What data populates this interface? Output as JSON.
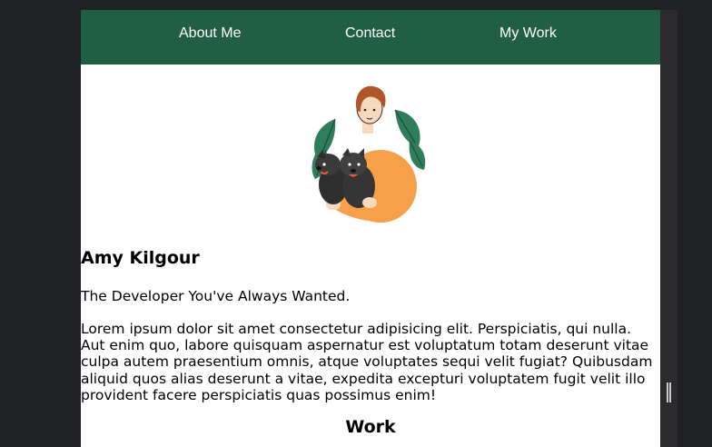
{
  "nav": {
    "links": [
      {
        "label": "About Me"
      },
      {
        "label": "Contact"
      },
      {
        "label": "My Work"
      }
    ]
  },
  "profile": {
    "name": "Amy Kilgour",
    "tagline": "The Developer You've Always Wanted.",
    "bio": "Lorem ipsum dolor sit amet consectetur adipisicing elit. Perspiciatis, qui nulla. Aut enim quo, labore quisquam aspernatur est voluptatum totam deserunt vitae culpa autem praesentium omnis, atque voluptates sequi velit fugiat? Quibusdam aliquid quos alias deserunt a vitae, expedita excepturi voluptatem fugit velit illo provident facere perspiciatis quas possimus enim!"
  },
  "sections": {
    "work_heading": "Work"
  },
  "colors": {
    "nav_background": "#215f45",
    "page_background": "#ffffff",
    "outer_background": "#202124",
    "sweater": "#f7a04a",
    "leaf": "#2f7d5b",
    "hair": "#b0562b"
  },
  "icons": {
    "hero": "person-with-dogs-illustration",
    "scrollbar": "scroll-grip-icon"
  }
}
